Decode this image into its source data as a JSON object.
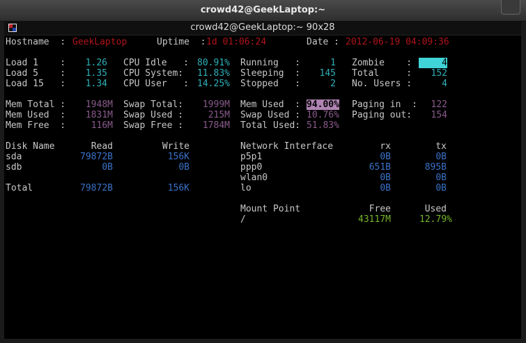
{
  "window": {
    "title": "crowd42@GeekLaptop:~",
    "tab_title": "crowd42@GeekLaptop:~ 90x28"
  },
  "header": {
    "hostname_label": "Hostname  :",
    "hostname": "GeekLaptop",
    "uptime_label": "Uptime  :",
    "uptime": "1d 01:06:24",
    "date_label": "Date :",
    "date": "2012-06-19 04:09:36"
  },
  "load": [
    {
      "label": "Load 1    :",
      "value": "1.26"
    },
    {
      "label": "Load 5    :",
      "value": "1.35"
    },
    {
      "label": "Load 15   :",
      "value": "1.34"
    }
  ],
  "cpu": [
    {
      "label": "CPU Idle   :",
      "value": "80.91%"
    },
    {
      "label": "CPU System:",
      "value": "11.83%"
    },
    {
      "label": "CPU User   :",
      "value": "14.25%"
    }
  ],
  "procs": [
    {
      "label": "Running   :",
      "value": "1"
    },
    {
      "label": "Sleeping  :",
      "value": "145"
    },
    {
      "label": "Stopped   :",
      "value": "2"
    }
  ],
  "procs2": [
    {
      "label": "Zombie    :",
      "value": "4"
    },
    {
      "label": "Total     :",
      "value": "152"
    },
    {
      "label": "No. Users :",
      "value": "4"
    }
  ],
  "mem": [
    {
      "label": "Mem Total :",
      "value": "1948M"
    },
    {
      "label": "Mem Used  :",
      "value": "1831M"
    },
    {
      "label": "Mem Free  :",
      "value": "116M"
    }
  ],
  "swap": [
    {
      "label": "Swap Total:",
      "value": "1999M"
    },
    {
      "label": "Swap Used :",
      "value": "215M"
    },
    {
      "label": "Swap Free :",
      "value": "1784M"
    }
  ],
  "memused": [
    {
      "label": "Mem Used  :",
      "value": "94.00%"
    },
    {
      "label": "Swap Used :",
      "value": "10.76%"
    },
    {
      "label": "Total Used:",
      "value": "51.83%"
    }
  ],
  "paging": [
    {
      "label": "Paging in  :",
      "value": "122"
    },
    {
      "label": "Paging out:",
      "value": "154"
    }
  ],
  "disk": {
    "headers": [
      "Disk Name",
      "Read",
      "Write"
    ],
    "rows": [
      {
        "name": "sda",
        "read": "79872B",
        "write": "156K"
      },
      {
        "name": "sdb",
        "read": "0B",
        "write": "0B"
      }
    ],
    "total": {
      "name": "Total",
      "read": "79872B",
      "write": "156K"
    }
  },
  "net": {
    "headers": [
      "Network Interface",
      "rx",
      "tx"
    ],
    "rows": [
      {
        "name": "p5p1",
        "rx": "0B",
        "tx": "0B"
      },
      {
        "name": "ppp0",
        "rx": "651B",
        "tx": "895B"
      },
      {
        "name": "wlan0",
        "rx": "0B",
        "tx": "0B"
      },
      {
        "name": "lo",
        "rx": "0B",
        "tx": "0B"
      }
    ]
  },
  "mount": {
    "headers": [
      "Mount Point",
      "Free",
      "Used"
    ],
    "rows": [
      {
        "name": "/",
        "free": "43117M",
        "used": "12.79%"
      }
    ]
  },
  "colors": {
    "accent_red": "#b0141a",
    "cyan": "#2fb0b8",
    "purple": "#8a5a8c",
    "blue": "#3a72c8",
    "green": "#76b52a"
  }
}
